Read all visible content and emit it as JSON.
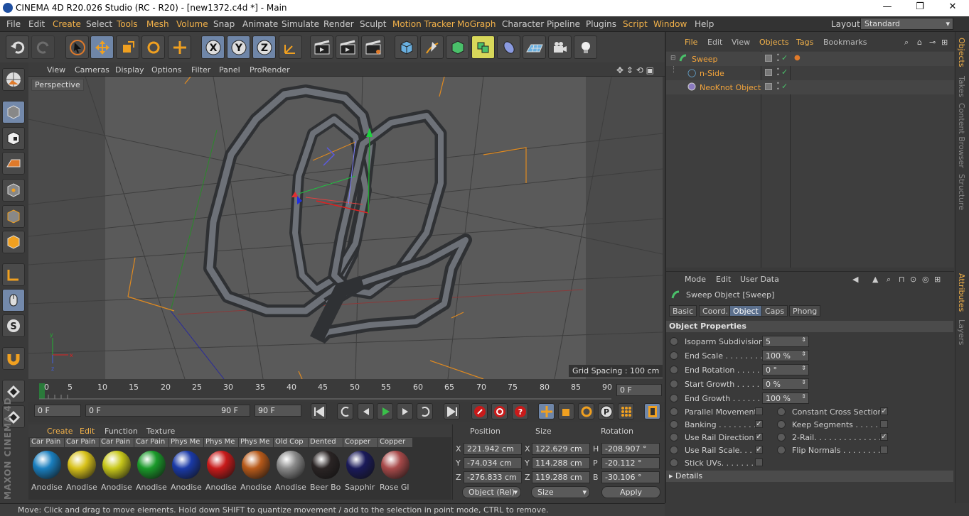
{
  "window": {
    "title": "CINEMA 4D R20.026 Studio (RC - R20) - [new1372.c4d *] - Main",
    "minimize": "—",
    "maximize": "❐",
    "close": "✕"
  },
  "menubar": {
    "items": [
      "File",
      "Edit",
      "Create",
      "Select",
      "Tools",
      "Mesh",
      "Volume",
      "Snap",
      "Animate",
      "Simulate",
      "Render",
      "Sculpt",
      "Motion Tracker",
      "MoGraph",
      "Character",
      "Pipeline",
      "Plugins",
      "Script",
      "Window",
      "Help"
    ],
    "layout_label": "Layout:",
    "layout_value": "Standard"
  },
  "viewport": {
    "menu": [
      "View",
      "Cameras",
      "Display",
      "Options",
      "Filter",
      "Panel",
      "ProRender"
    ],
    "camera": "Perspective",
    "grid_spacing": "Grid Spacing : 100 cm"
  },
  "timeline": {
    "ticks": [
      "0",
      "5",
      "10",
      "15",
      "20",
      "25",
      "30",
      "35",
      "40",
      "45",
      "50",
      "55",
      "60",
      "65",
      "70",
      "75",
      "80",
      "85",
      "90"
    ],
    "end_field": "0 F",
    "current": "0 F",
    "range_start": "0 F",
    "range_end": "90 F",
    "max": "90 F"
  },
  "materials": {
    "menu": [
      "Create",
      "Edit",
      "Function",
      "Texture"
    ],
    "items": [
      {
        "top": "Car Pain",
        "bottom": "Anodise",
        "color": "#1a7fbf"
      },
      {
        "top": "Car Pain",
        "bottom": "Anodise",
        "color": "#d8c21a"
      },
      {
        "top": "Car Pain",
        "bottom": "Anodise",
        "color": "#c8c81a"
      },
      {
        "top": "Car Pain",
        "bottom": "Anodise",
        "color": "#1a9a2a"
      },
      {
        "top": "Phys Me",
        "bottom": "Anodise",
        "color": "#1a3aa8"
      },
      {
        "top": "Phys Me",
        "bottom": "Anodise",
        "color": "#c81a1a"
      },
      {
        "top": "Phys Me",
        "bottom": "Anodise",
        "color": "#b85a1a"
      },
      {
        "top": "Old Cop",
        "bottom": "Anodise",
        "color": "#8a8a8a"
      },
      {
        "top": "Dented",
        "bottom": "Beer Bo",
        "color": "#2a2424"
      },
      {
        "top": "Copper",
        "bottom": "Sapphir",
        "color": "#1a1a5a"
      },
      {
        "top": "Copper",
        "bottom": "Rose Gl",
        "color": "#a84a4a"
      }
    ]
  },
  "coordinates": {
    "headers": [
      "Position",
      "Size",
      "Rotation"
    ],
    "rows": [
      {
        "axis": "X",
        "pos": "221.942 cm",
        "saxis": "X",
        "size": "122.629 cm",
        "raxis": "H",
        "rot": "-208.907 °"
      },
      {
        "axis": "Y",
        "pos": "-74.034 cm",
        "saxis": "Y",
        "size": "114.288 cm",
        "raxis": "P",
        "rot": "-20.112 °"
      },
      {
        "axis": "Z",
        "pos": "-276.833 cm",
        "saxis": "Z",
        "size": "119.288 cm",
        "raxis": "B",
        "rot": "-30.106 °"
      }
    ],
    "mode": "Object (Rel)",
    "size_mode": "Size",
    "apply": "Apply"
  },
  "status": "Move: Click and drag to move elements. Hold down SHIFT to quantize movement / add to the selection in point mode, CTRL to remove.",
  "branding": "MAXON CINEMA 4D",
  "objects": {
    "menu": [
      "File",
      "Edit",
      "View",
      "Objects",
      "Tags",
      "Bookmarks"
    ],
    "tree": [
      {
        "name": "Sweep",
        "indent": 0
      },
      {
        "name": "n-Side",
        "indent": 1
      },
      {
        "name": "NeoKnot Object",
        "indent": 1
      }
    ]
  },
  "sidetabs": [
    "Objects",
    "Takes",
    "Content Browser",
    "Structure",
    "Attributes",
    "Layers"
  ],
  "attributes": {
    "menu": [
      "Mode",
      "Edit",
      "User Data"
    ],
    "object_title": "Sweep Object [Sweep]",
    "tabs": [
      "Basic",
      "Coord.",
      "Object",
      "Caps",
      "Phong"
    ],
    "active_tab": "Object",
    "section": "Object Properties",
    "fields": [
      {
        "label": "Isoparm Subdivision",
        "value": "5"
      },
      {
        "label": "End Scale . . . . . . . . . .",
        "value": "100 %"
      },
      {
        "label": "End Rotation . . . . . .",
        "value": "0 °"
      },
      {
        "label": "Start Growth . . . . . .",
        "value": "0 %"
      },
      {
        "label": "End Growth . . . . . . .",
        "value": "100 %"
      }
    ],
    "checks_left": [
      {
        "label": "Parallel Movement",
        "checked": false
      },
      {
        "label": "Banking . . . . . . . . .",
        "checked": true
      },
      {
        "label": "Use Rail Direction",
        "checked": true
      },
      {
        "label": "Use Rail Scale. . . .",
        "checked": true
      },
      {
        "label": "Stick UVs. . . . . . . .",
        "checked": false
      }
    ],
    "checks_right": [
      {
        "label": "Constant Cross Section",
        "checked": true
      },
      {
        "label": "Keep Segments . . . . . . .",
        "checked": false
      },
      {
        "label": "2-Rail. . . . . . . . . . . . . . .",
        "checked": true
      },
      {
        "label": "Flip Normals . . . . . . . . .",
        "checked": false
      }
    ],
    "details": "Details"
  }
}
